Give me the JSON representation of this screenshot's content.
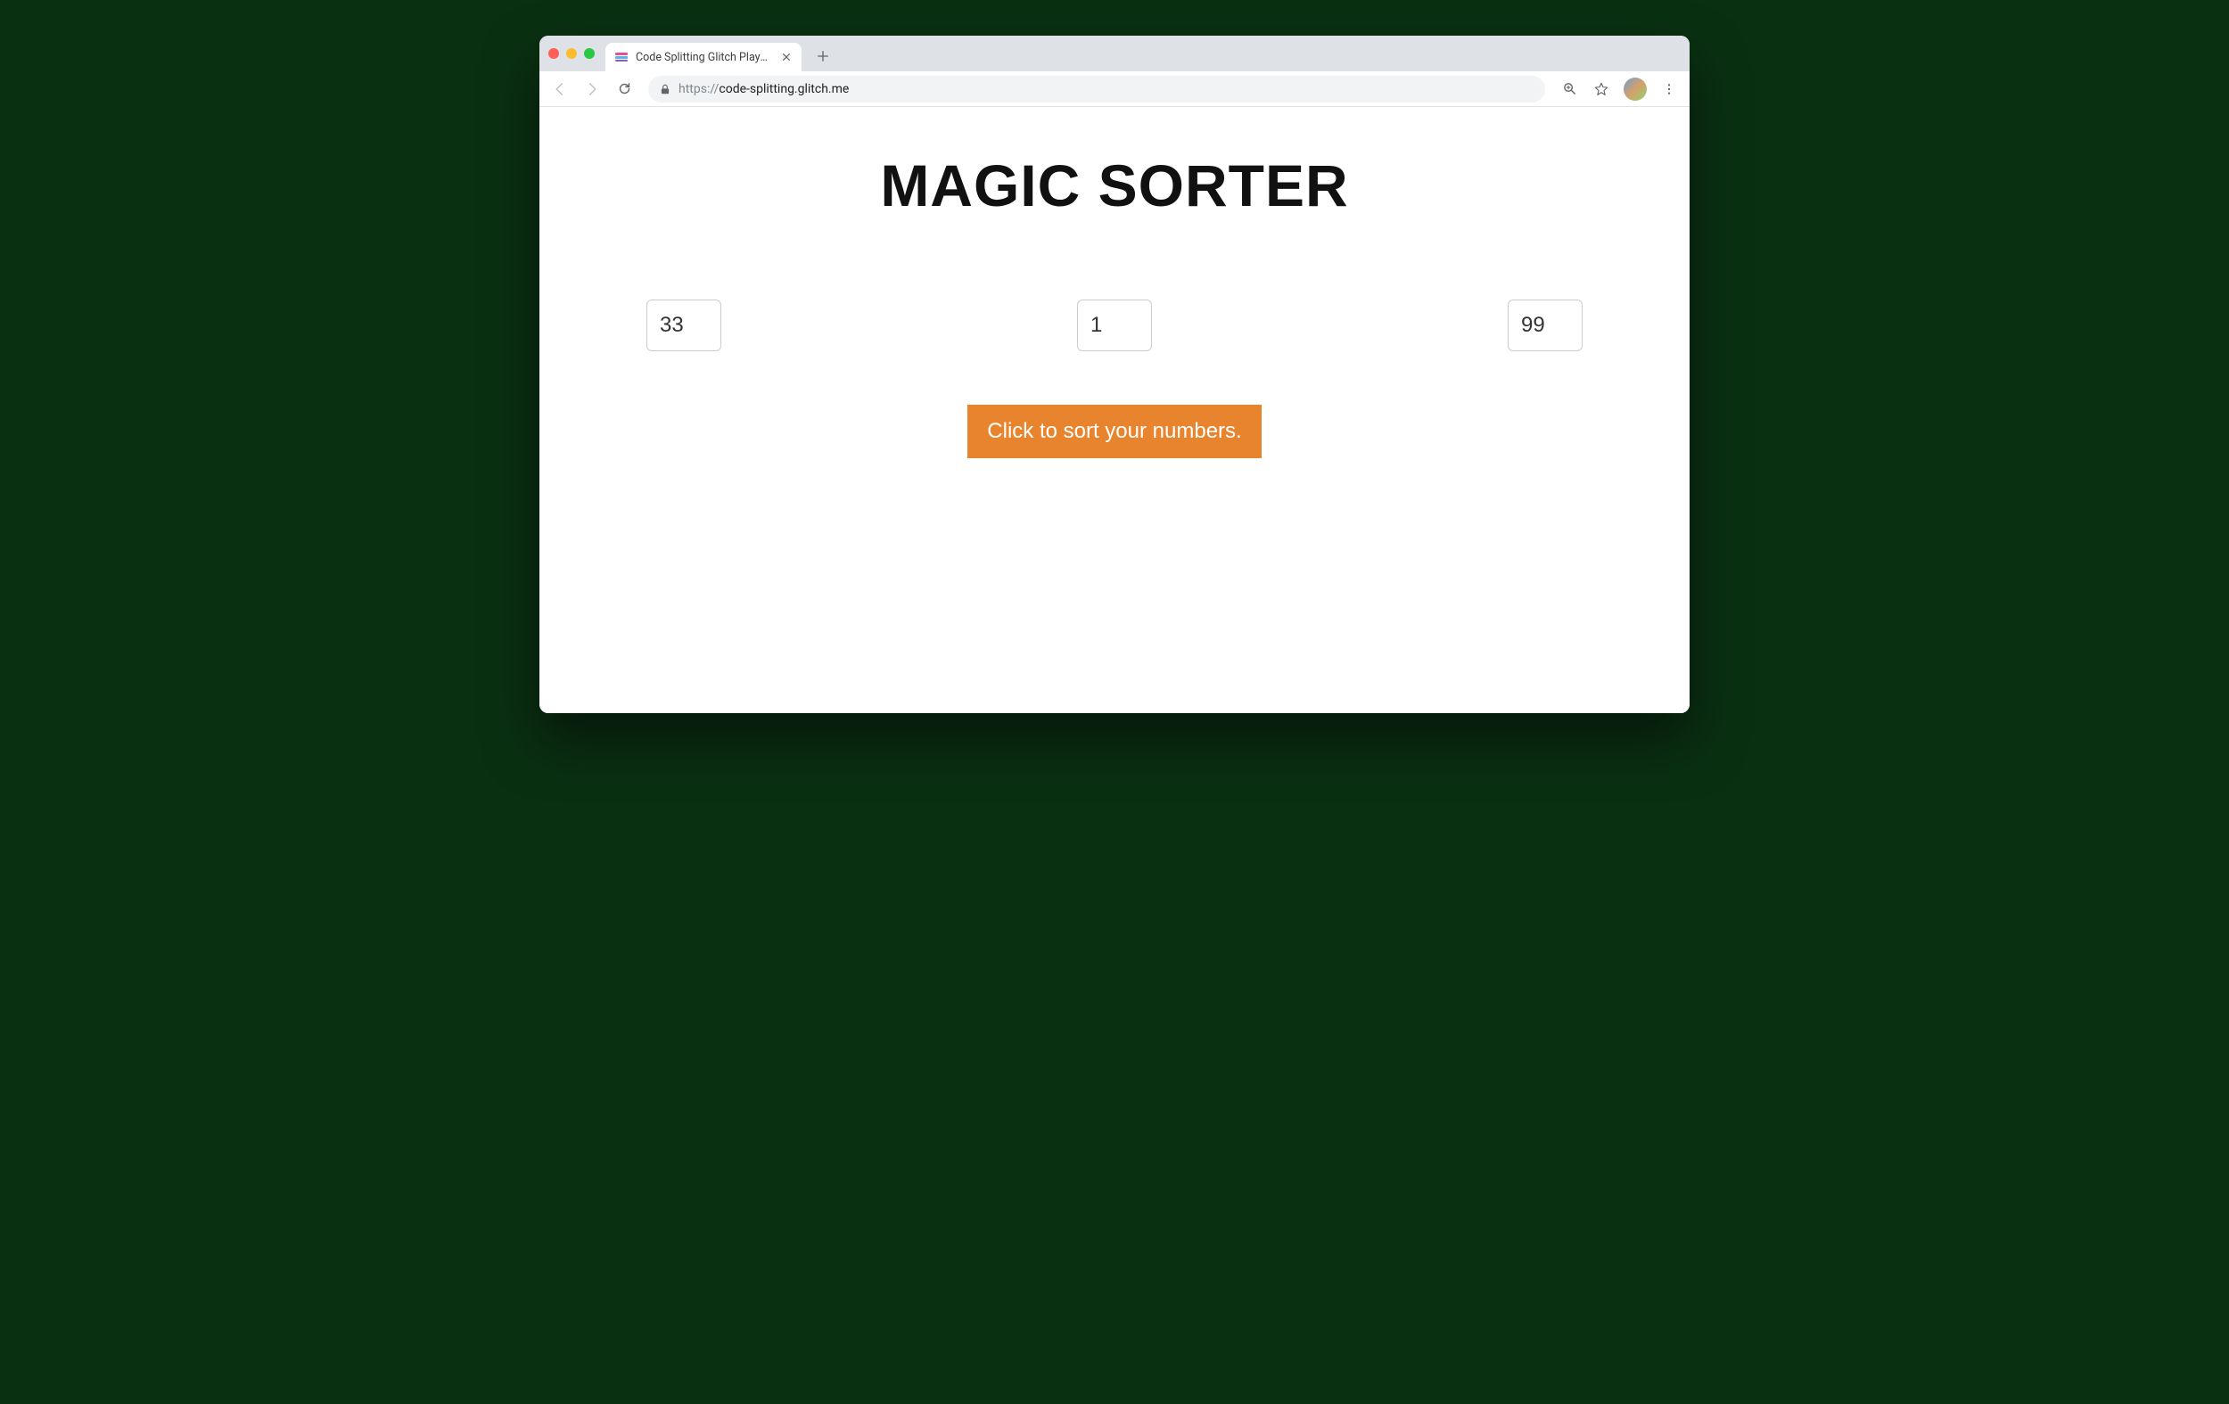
{
  "browser": {
    "tab": {
      "title": "Code Splitting Glitch Playgroun"
    },
    "url_protocol": "https://",
    "url_rest": "code-splitting.glitch.me"
  },
  "page": {
    "title": "MAGIC SORTER",
    "inputs": {
      "a": "33",
      "b": "1",
      "c": "99"
    },
    "button_label": "Click to sort your numbers."
  },
  "colors": {
    "accent": "#e8842e"
  }
}
